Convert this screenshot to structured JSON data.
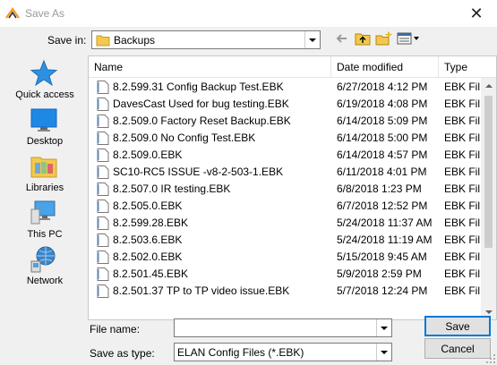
{
  "window": {
    "title": "Save As",
    "close_glyph": "✕"
  },
  "toolbar": {
    "save_in_label": "Save in:",
    "save_in_value": "Backups",
    "back_icon": "back-arrow-icon",
    "up_icon": "up-folder-icon",
    "new_folder_icon": "new-folder-icon",
    "view_menu_icon": "view-menu-icon"
  },
  "places": [
    {
      "label": "Quick access",
      "icon": "quick-access-star-icon"
    },
    {
      "label": "Desktop",
      "icon": "desktop-icon"
    },
    {
      "label": "Libraries",
      "icon": "libraries-icon"
    },
    {
      "label": "This PC",
      "icon": "this-pc-icon"
    },
    {
      "label": "Network",
      "icon": "network-icon"
    }
  ],
  "file_list": {
    "columns": [
      "Name",
      "Date modified",
      "Type"
    ],
    "rows": [
      {
        "name": "8.2.599.31 Config Backup Test.EBK",
        "date": "6/27/2018 4:12 PM",
        "type": "EBK Fil"
      },
      {
        "name": "DavesCast Used for bug testing.EBK",
        "date": "6/19/2018 4:08 PM",
        "type": "EBK Fil"
      },
      {
        "name": "8.2.509.0 Factory Reset Backup.EBK",
        "date": "6/14/2018 5:09 PM",
        "type": "EBK Fil"
      },
      {
        "name": "8.2.509.0 No Config Test.EBK",
        "date": "6/14/2018 5:00 PM",
        "type": "EBK Fil"
      },
      {
        "name": "8.2.509.0.EBK",
        "date": "6/14/2018 4:57 PM",
        "type": "EBK Fil"
      },
      {
        "name": "SC10-RC5 ISSUE -v8-2-503-1.EBK",
        "date": "6/11/2018 4:01 PM",
        "type": "EBK Fil"
      },
      {
        "name": "8.2.507.0 IR testing.EBK",
        "date": "6/8/2018 1:23 PM",
        "type": "EBK Fil"
      },
      {
        "name": "8.2.505.0.EBK",
        "date": "6/7/2018 12:52 PM",
        "type": "EBK Fil"
      },
      {
        "name": "8.2.599.28.EBK",
        "date": "5/24/2018 11:37 AM",
        "type": "EBK Fil"
      },
      {
        "name": "8.2.503.6.EBK",
        "date": "5/24/2018 11:19 AM",
        "type": "EBK Fil"
      },
      {
        "name": "8.2.502.0.EBK",
        "date": "5/15/2018 9:45 AM",
        "type": "EBK Fil"
      },
      {
        "name": "8.2.501.45.EBK",
        "date": "5/9/2018 2:59 PM",
        "type": "EBK Fil"
      },
      {
        "name": "8.2.501.37 TP to TP video issue.EBK",
        "date": "5/7/2018 12:24 PM",
        "type": "EBK Fil"
      }
    ]
  },
  "form": {
    "file_name_label": "File name:",
    "file_name_value": "",
    "save_as_type_label": "Save as type:",
    "save_as_type_value": "ELAN Config Files (*.EBK)"
  },
  "buttons": {
    "save": "Save",
    "cancel": "Cancel"
  },
  "colors": {
    "accent": "#0078d7",
    "folder": "#e8b94a",
    "desktop": "#1e88e5"
  }
}
